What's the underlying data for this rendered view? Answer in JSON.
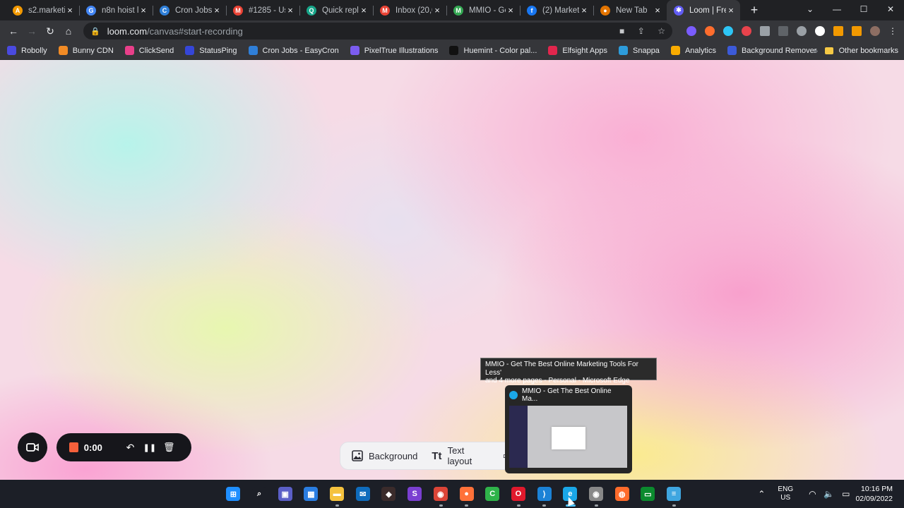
{
  "tabs": [
    {
      "title": "s2.marketin",
      "color": "#f29900",
      "glyph": "A",
      "active": false
    },
    {
      "title": "n8n hoist le",
      "color": "#4285f4",
      "glyph": "G",
      "active": false
    },
    {
      "title": "Cron Jobs -",
      "color": "#2f7fd8",
      "glyph": "C",
      "active": false
    },
    {
      "title": "#1285 - Us",
      "color": "#ea4335",
      "glyph": "M",
      "active": false
    },
    {
      "title": "Quick reply",
      "color": "#17a589",
      "glyph": "Q",
      "active": false
    },
    {
      "title": "Inbox (20,0",
      "color": "#ea4335",
      "glyph": "M",
      "active": false
    },
    {
      "title": "MMIO - Ge",
      "color": "#34a853",
      "glyph": "M",
      "active": false
    },
    {
      "title": "(2) Marketin",
      "color": "#1877f2",
      "glyph": "f",
      "active": false
    },
    {
      "title": "New Tab",
      "color": "#e37400",
      "glyph": "●",
      "active": false
    },
    {
      "title": "Loom | Free",
      "color": "#625df5",
      "glyph": "✱",
      "active": true
    }
  ],
  "window_controls": {
    "minimize": "—",
    "maximize": "☐",
    "close": "✕",
    "tabsearch": "⌄"
  },
  "toolbar": {
    "back": "←",
    "forward": "→",
    "reload": "↻",
    "home": "⌂",
    "lock": "🔒",
    "url_host": "loom.com",
    "url_path": "/canvas#start-recording"
  },
  "bookmarks": [
    {
      "label": "Robolly",
      "color": "#4a4ae0"
    },
    {
      "label": "Bunny CDN",
      "color": "#f28b25"
    },
    {
      "label": "ClickSend",
      "color": "#e83f8a"
    },
    {
      "label": "StatusPing",
      "color": "#3546d8"
    },
    {
      "label": "Cron Jobs - EasyCron",
      "color": "#2f7fd8"
    },
    {
      "label": "PixelTrue Illustrations",
      "color": "#7b5cf0"
    },
    {
      "label": "Huemint - Color pal...",
      "color": "#111111"
    },
    {
      "label": "Elfsight Apps",
      "color": "#e2264d"
    },
    {
      "label": "Snappa",
      "color": "#2d9cdb"
    },
    {
      "label": "Analytics",
      "color": "#f9ab00"
    },
    {
      "label": "Background Remover",
      "color": "#3c5ad8"
    }
  ],
  "bookmarks_more": "»",
  "other_bookmarks": "Other bookmarks",
  "recorder": {
    "timer": "0:00",
    "undo": "↶",
    "pause": "❚❚",
    "delete": "🗑"
  },
  "layout_bar": {
    "background_label": "Background",
    "text_layout_label": "Text layout",
    "text_icon": "Tt"
  },
  "tooltip": {
    "line1": "MMIO - Get The Best Online Marketing Tools For Less'",
    "line2": "and 4 more pages - Personal - Microsoft Edge"
  },
  "preview": {
    "title": "MMIO - Get The Best Online Ma..."
  },
  "taskbar": {
    "apps": [
      {
        "name": "start",
        "color": "#1f8fff",
        "glyph": "⊞",
        "run": false
      },
      {
        "name": "search",
        "color": "#1c1f27",
        "glyph": "⌕",
        "run": false
      },
      {
        "name": "teams-chat",
        "color": "#5b5fc7",
        "glyph": "▣",
        "run": false
      },
      {
        "name": "store",
        "color": "#2a7de1",
        "glyph": "▦",
        "run": false
      },
      {
        "name": "file-explorer",
        "color": "#f5c23e",
        "glyph": "▬",
        "run": true
      },
      {
        "name": "mail",
        "color": "#0f6cbd",
        "glyph": "✉",
        "run": false
      },
      {
        "name": "game",
        "color": "#3a2b2b",
        "glyph": "◆",
        "run": false
      },
      {
        "name": "skype-style",
        "color": "#7a3fd1",
        "glyph": "S",
        "run": false
      },
      {
        "name": "chrome",
        "color": "#db4437",
        "glyph": "◉",
        "run": true
      },
      {
        "name": "firefox",
        "color": "#ff7139",
        "glyph": "●",
        "run": true
      },
      {
        "name": "camtasia",
        "color": "#2fb34a",
        "glyph": "C",
        "run": false
      },
      {
        "name": "opera",
        "color": "#e0192c",
        "glyph": "O",
        "run": true
      },
      {
        "name": "vscode",
        "color": "#1b82d6",
        "glyph": "⟩",
        "run": true
      },
      {
        "name": "edge",
        "color": "#1aa7e8",
        "glyph": "e",
        "run": true,
        "active": true
      },
      {
        "name": "chrome-2",
        "color": "#888888",
        "glyph": "◉",
        "run": true
      },
      {
        "name": "brave-orange",
        "color": "#ff6b2b",
        "glyph": "◍",
        "run": false
      },
      {
        "name": "terminal",
        "color": "#0b8a2e",
        "glyph": "▭",
        "run": false
      },
      {
        "name": "notepad",
        "color": "#3fa6e0",
        "glyph": "≡",
        "run": true
      }
    ],
    "tray": {
      "lang1": "ENG",
      "lang2": "US",
      "time": "10:16 PM",
      "date": "02/09/2022"
    }
  },
  "colors": {
    "record_stop": "#f5603b",
    "recorder_bg": "#16161b",
    "accent_taskbar": "#4cc2ff"
  }
}
